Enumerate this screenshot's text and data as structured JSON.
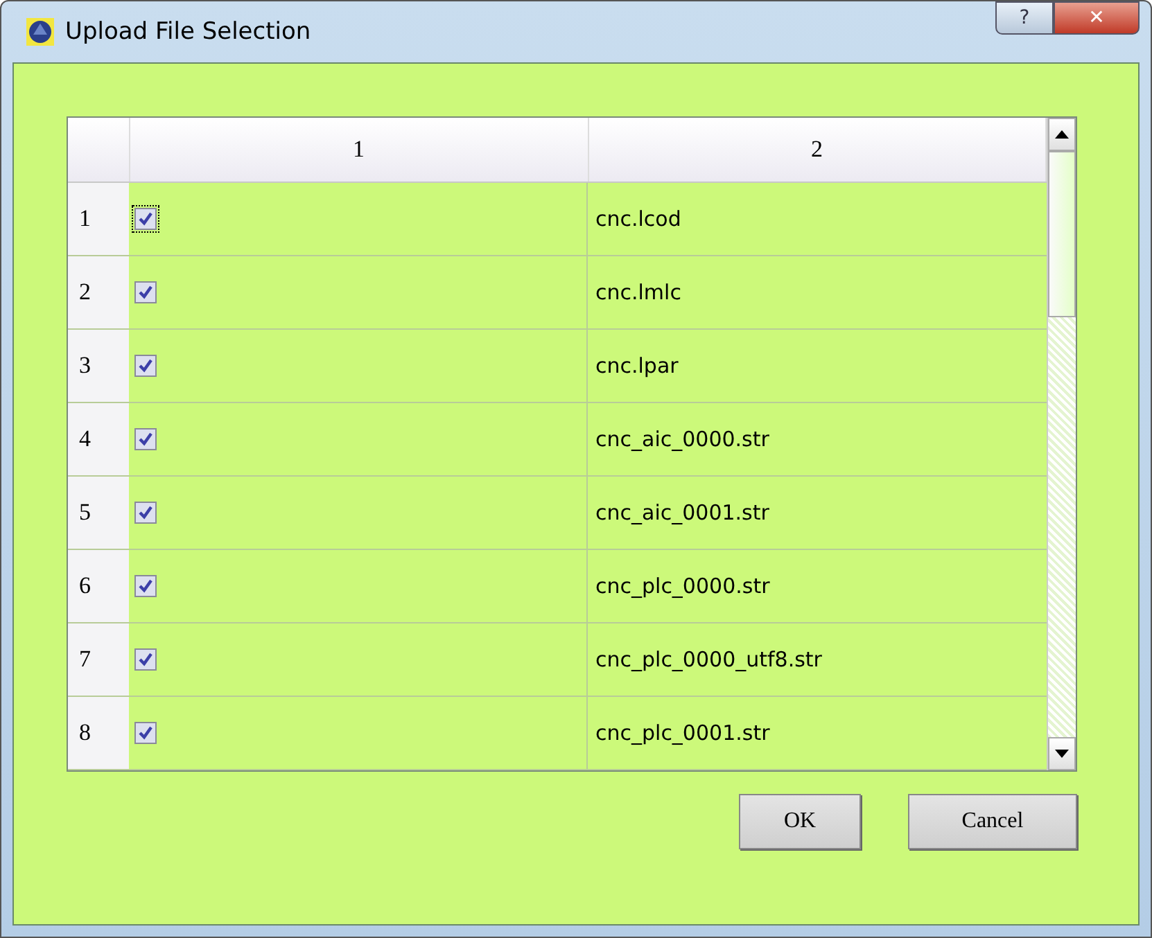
{
  "window": {
    "title": "Upload File Selection",
    "help_button": "?",
    "close_button": "✕"
  },
  "table": {
    "columns": [
      "1",
      "2"
    ],
    "rows": [
      {
        "number": "1",
        "checked": true,
        "focused": true,
        "file": "cnc.lcod"
      },
      {
        "number": "2",
        "checked": true,
        "focused": false,
        "file": "cnc.lmlc"
      },
      {
        "number": "3",
        "checked": true,
        "focused": false,
        "file": "cnc.lpar"
      },
      {
        "number": "4",
        "checked": true,
        "focused": false,
        "file": "cnc_aic_0000.str"
      },
      {
        "number": "5",
        "checked": true,
        "focused": false,
        "file": "cnc_aic_0001.str"
      },
      {
        "number": "6",
        "checked": true,
        "focused": false,
        "file": "cnc_plc_0000.str"
      },
      {
        "number": "7",
        "checked": true,
        "focused": false,
        "file": "cnc_plc_0000_utf8.str"
      },
      {
        "number": "8",
        "checked": true,
        "focused": false,
        "file": "cnc_plc_0001.str"
      }
    ]
  },
  "buttons": [
    "OK",
    "Cancel"
  ]
}
